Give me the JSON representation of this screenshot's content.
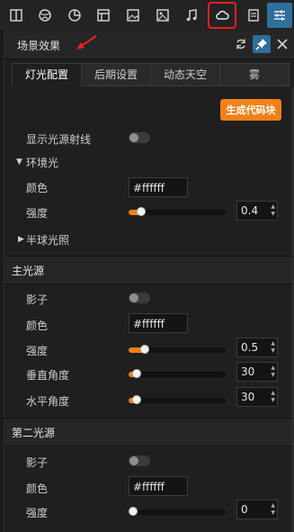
{
  "toolbar": {
    "icons": [
      "book-icon",
      "globe-icon",
      "chart-pie-icon",
      "layout-icon",
      "image-icon",
      "picture-icon",
      "music-icon",
      "cloud-icon",
      "notes-icon",
      "sliders-icon"
    ],
    "active": "cloud-icon"
  },
  "panel": {
    "title": "场景效果",
    "tabs": [
      "灯光配置",
      "后期设置",
      "动态天空",
      "雾"
    ],
    "active_tab": "灯光配置",
    "generate_code": "生成代码块"
  },
  "light": {
    "show_rays_label": "显示光源射线",
    "ambient_label": "环境光",
    "color_label": "颜色",
    "color_value": "#ffffff",
    "intensity_label": "强度",
    "intensity_value": "0.4",
    "intensity_level": 0.13,
    "hemisphere_label": "半球光照"
  },
  "main_light": {
    "title": "主光源",
    "shadow_label": "影子",
    "color_label": "颜色",
    "color_value": "#ffffff",
    "intensity_label": "强度",
    "intensity_value": "0.5",
    "intensity_level": 0.17,
    "vertical_label": "垂直角度",
    "vertical_value": "30",
    "vertical_level": 0.08,
    "horizontal_label": "水平角度",
    "horizontal_value": "30",
    "horizontal_level": 0.08
  },
  "second_light": {
    "title": "第二光源",
    "shadow_label": "影子",
    "color_label": "颜色",
    "color_value": "#ffffff",
    "intensity_label": "强度",
    "intensity_value": "0",
    "intensity_level": 0.0
  },
  "colors": {
    "accent": "#f0801a",
    "active_outline": "#e8211c",
    "pin": "#2f6d9c"
  }
}
